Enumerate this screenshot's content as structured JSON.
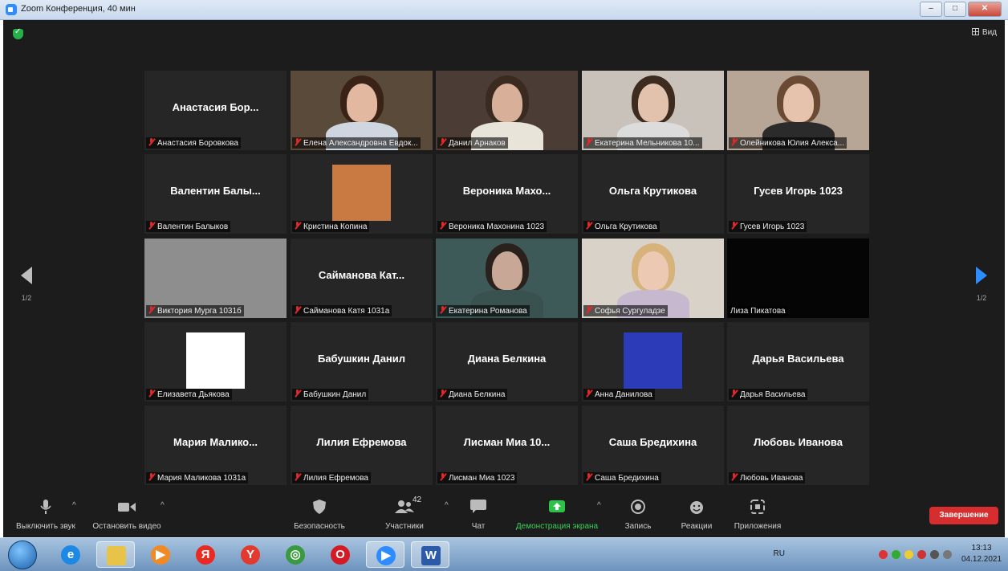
{
  "window": {
    "title": "Zoom Конференция, 40 мин",
    "controls": [
      "–",
      "□",
      "✕"
    ]
  },
  "header": {
    "view_label": "Вид"
  },
  "pager": {
    "left": "1/2",
    "right": "1/2"
  },
  "tiles": [
    {
      "name": "Анастасия Боровкова",
      "big": "Анастасия  Бор...",
      "video": false,
      "muted": true
    },
    {
      "name": "Елена Александровна Евдок...",
      "big": "",
      "video": true,
      "muted": true,
      "active": true,
      "bg": "#5a4a3a",
      "face": "#e2b9a0",
      "hair": "#3a2216",
      "shirt": "#cfd6e0"
    },
    {
      "name": "Данил Арнаков",
      "big": "",
      "video": true,
      "muted": true,
      "bg": "#4b3d35",
      "face": "#d8b09a",
      "hair": "#3b2a20",
      "shirt": "#e8e4da"
    },
    {
      "name": "Екатерина Мельникова 10...",
      "big": "",
      "video": true,
      "muted": true,
      "bg": "#c9c2ba",
      "face": "#e3c2ad",
      "hair": "#3d2b20",
      "shirt": "#dcdcdc"
    },
    {
      "name": "Олейникова Юлия Алекса...",
      "big": "",
      "video": true,
      "muted": true,
      "bg": "#b7a596",
      "face": "#e6c3ad",
      "hair": "#6b4a34",
      "shirt": "#2b2b2b"
    },
    {
      "name": "Валентин Балыков",
      "big": "Валентин  Балы...",
      "video": false,
      "muted": true
    },
    {
      "name": "Кристина Копина",
      "big": "",
      "video": false,
      "muted": true,
      "avatar": "#c87a42"
    },
    {
      "name": "Вероника Махонина 1023",
      "big": "Вероника  Махо...",
      "video": false,
      "muted": true
    },
    {
      "name": "Ольга Крутикова",
      "big": "Ольга Крутикова",
      "video": false,
      "muted": true
    },
    {
      "name": "Гусев Игорь 1023",
      "big": "Гусев Игорь 1023",
      "video": false,
      "muted": true
    },
    {
      "name": "Виктория Мурга 1031б",
      "big": "",
      "video": true,
      "muted": true,
      "bg": "#8e8e8e",
      "face": "",
      "hair": "",
      "shirt": ""
    },
    {
      "name": "Сайманова Катя 1031а",
      "big": "Сайманова  Кат...",
      "video": false,
      "muted": true
    },
    {
      "name": "Екатерина Романова",
      "big": "",
      "video": true,
      "muted": true,
      "bg": "#3e5a58",
      "face": "#c9a796",
      "hair": "#2a211c",
      "shirt": "#39514f"
    },
    {
      "name": "Софья Сургуладзе",
      "big": "",
      "video": true,
      "muted": true,
      "bg": "#d8d2c9",
      "face": "#ecc9b3",
      "hair": "#d7b27a",
      "shirt": "#c6b9cf"
    },
    {
      "name": "Лиза Пикатова",
      "big": "",
      "video": true,
      "muted": false,
      "bg": "#050505",
      "face": "",
      "hair": "",
      "shirt": ""
    },
    {
      "name": "Елизавета Дьякова",
      "big": "",
      "video": false,
      "muted": true,
      "avatar": "#ffffff"
    },
    {
      "name": "Бабушкин Данил",
      "big": "Бабушкин Данил",
      "video": false,
      "muted": true
    },
    {
      "name": "Диана Белкина",
      "big": "Диана Белкина",
      "video": false,
      "muted": true
    },
    {
      "name": "Анна Данилова",
      "big": "",
      "video": false,
      "muted": true,
      "avatar": "#2c3bb8"
    },
    {
      "name": "Дарья Васильева",
      "big": "Дарья Васильева",
      "video": false,
      "muted": true
    },
    {
      "name": "Мария Маликова 1031а",
      "big": "Мария  Малико...",
      "video": false,
      "muted": true
    },
    {
      "name": "Лилия Ефремова",
      "big": "Лилия Ефремова",
      "video": false,
      "muted": true
    },
    {
      "name": "Лисман Миа 1023",
      "big": "Лисман  Миа  10...",
      "video": false,
      "muted": true
    },
    {
      "name": "Саша Бредихина",
      "big": "Саша Бредихина",
      "video": false,
      "muted": true
    },
    {
      "name": "Любовь Иванова",
      "big": "Любовь Иванова",
      "video": false,
      "muted": true
    }
  ],
  "toolbar": {
    "mute": "Выключить звук",
    "video": "Остановить видео",
    "security": "Безопасность",
    "participants": "Участники",
    "participants_count": "42",
    "chat": "Чат",
    "share": "Демонстрация экрана",
    "record": "Запись",
    "reactions": "Реакции",
    "apps": "Приложения",
    "end": "Завершение"
  },
  "taskbar": {
    "apps": [
      {
        "icon": "ie-icon",
        "color": "#1e88e5",
        "glyph": "e"
      },
      {
        "icon": "folder-icon",
        "color": "#e8c34a",
        "glyph": ""
      },
      {
        "icon": "media-player-icon",
        "color": "#f08a24",
        "glyph": "▶"
      },
      {
        "icon": "yandex-icon",
        "color": "#e82a22",
        "glyph": "Я"
      },
      {
        "icon": "yandex-browser-icon",
        "color": "#e23a2e",
        "glyph": "Y"
      },
      {
        "icon": "chrome-icon",
        "color": "#3a9a3f",
        "glyph": "◎"
      },
      {
        "icon": "opera-icon",
        "color": "#d61a24",
        "glyph": "O"
      },
      {
        "icon": "zoom-icon",
        "color": "#2d8cff",
        "glyph": "▶"
      },
      {
        "icon": "word-icon",
        "color": "#2a5aa8",
        "glyph": "W"
      }
    ],
    "lang": "RU",
    "time": "13:13",
    "date": "04.12.2021"
  }
}
